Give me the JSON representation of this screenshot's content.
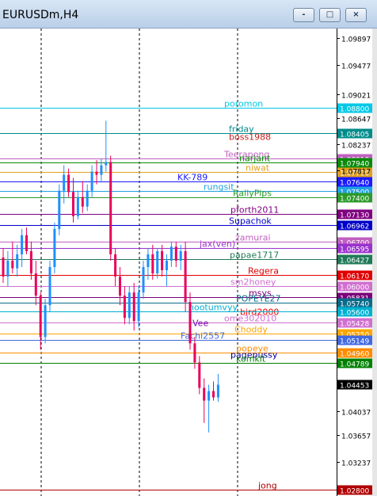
{
  "window": {
    "title": "EURUSDm,H4",
    "buttons": {
      "minimize": "-",
      "restore": "□",
      "close": "×"
    }
  },
  "colors": {
    "bull": "#1e8fff",
    "bear": "#e8005a",
    "grid": "#000000",
    "axis_bg": "#ffffff"
  },
  "chart_data": {
    "type": "candlestick",
    "price_axis": {
      "tick_labels": [
        "1.09897",
        "1.09477",
        "1.09021",
        "1.08647",
        "1.08237",
        "1.07817",
        "1.04037",
        "1.03657",
        "1.03237"
      ],
      "current_price": "1.04453"
    },
    "levels": [
      {
        "name": "poromon",
        "price": "1.08800",
        "color": "#00c8e6"
      },
      {
        "name": "friday",
        "price": "1.08405",
        "color": "#008b8b"
      },
      {
        "name": "boss1988",
        "price": "",
        "color": "#c81e1e"
      },
      {
        "name": "Teerapong",
        "price": "1.08010",
        "color": "#c060c0"
      },
      {
        "name": "narjant",
        "price": "1.07940",
        "color": "#0a8a0a"
      },
      {
        "name": "niwat",
        "price": "1.07790",
        "color": "#e0a020"
      },
      {
        "name": "KK-789",
        "price": "1.07640",
        "color": "#1a1aff"
      },
      {
        "name": "rungsit",
        "price": "1.07500",
        "color": "#20a0e0"
      },
      {
        "name": "RallyPips",
        "price": "1.07400",
        "color": "#2a9a2a"
      },
      {
        "name": "pforth2011",
        "price": "1.07130",
        "color": "#800080"
      },
      {
        "name": "Supachok",
        "price": "1.06962",
        "color": "#0000c8"
      },
      {
        "name": "zamurai",
        "price": "1.06700",
        "color": "#c060c0"
      },
      {
        "name": "jax(ven)",
        "price": "1.06595",
        "color": "#9932cc"
      },
      {
        "name": "papae1717",
        "price": "1.06427",
        "color": "#207a57"
      },
      {
        "name": "Regera",
        "price": "1.06170",
        "color": "#e00000"
      },
      {
        "name": "sm2honey",
        "price": "1.06000",
        "color": "#d070d0"
      },
      {
        "name": "msys",
        "price": "1.05831",
        "color": "#7a007a"
      },
      {
        "name": "POPEYE27",
        "price": "1.05740",
        "color": "#0a6a8a"
      },
      {
        "name": "bird2000",
        "price": "",
        "color": "#ff0000"
      },
      {
        "name": "nootumvyy",
        "price": "1.05600",
        "color": "#00b0d0"
      },
      {
        "name": "ome302010",
        "price": "1.05428",
        "color": "#d070d0"
      },
      {
        "name": "Vee",
        "price": "",
        "color": "#7a00b0"
      },
      {
        "name": "Choddy",
        "price": "1.05250",
        "color": "#ffa500"
      },
      {
        "name": "Fachi2557",
        "price": "1.05149",
        "color": "#4169e1"
      },
      {
        "name": "popeye",
        "price": "1.04960",
        "color": "#ff8c00"
      },
      {
        "name": "pagepussy",
        "price": "",
        "color": "#0000a0"
      },
      {
        "name": "komkit",
        "price": "1.04789",
        "color": "#008000"
      },
      {
        "name": "jong",
        "price": "1.02800",
        "color": "#b00000"
      }
    ],
    "candles": [
      {
        "o": 1.0645,
        "h": 1.066,
        "l": 1.0605,
        "c": 1.0615
      },
      {
        "o": 1.0615,
        "h": 1.0655,
        "l": 1.06,
        "c": 1.064
      },
      {
        "o": 1.064,
        "h": 1.067,
        "l": 1.062,
        "c": 1.0628
      },
      {
        "o": 1.0628,
        "h": 1.0665,
        "l": 1.0615,
        "c": 1.065
      },
      {
        "o": 1.065,
        "h": 1.069,
        "l": 1.063,
        "c": 1.068
      },
      {
        "o": 1.068,
        "h": 1.0692,
        "l": 1.065,
        "c": 1.0655
      },
      {
        "o": 1.0655,
        "h": 1.067,
        "l": 1.061,
        "c": 1.062
      },
      {
        "o": 1.062,
        "h": 1.064,
        "l": 1.057,
        "c": 1.0585
      },
      {
        "o": 1.0585,
        "h": 1.059,
        "l": 1.05,
        "c": 1.052
      },
      {
        "o": 1.052,
        "h": 1.058,
        "l": 1.051,
        "c": 1.057
      },
      {
        "o": 1.057,
        "h": 1.064,
        "l": 1.056,
        "c": 1.063
      },
      {
        "o": 1.063,
        "h": 1.07,
        "l": 1.062,
        "c": 1.069
      },
      {
        "o": 1.069,
        "h": 1.076,
        "l": 1.068,
        "c": 1.075
      },
      {
        "o": 1.075,
        "h": 1.079,
        "l": 1.073,
        "c": 1.0775
      },
      {
        "o": 1.0775,
        "h": 1.0785,
        "l": 1.074,
        "c": 1.0748
      },
      {
        "o": 1.0748,
        "h": 1.077,
        "l": 1.07,
        "c": 1.071
      },
      {
        "o": 1.071,
        "h": 1.075,
        "l": 1.0705,
        "c": 1.074
      },
      {
        "o": 1.074,
        "h": 1.0765,
        "l": 1.0715,
        "c": 1.0725
      },
      {
        "o": 1.0725,
        "h": 1.076,
        "l": 1.0718,
        "c": 1.075
      },
      {
        "o": 1.075,
        "h": 1.079,
        "l": 1.074,
        "c": 1.078
      },
      {
        "o": 1.078,
        "h": 1.0798,
        "l": 1.076,
        "c": 1.0775
      },
      {
        "o": 1.0775,
        "h": 1.08,
        "l": 1.0765,
        "c": 1.079
      },
      {
        "o": 1.079,
        "h": 1.086,
        "l": 1.078,
        "c": 1.0795
      },
      {
        "o": 1.0795,
        "h": 1.0805,
        "l": 1.064,
        "c": 1.065
      },
      {
        "o": 1.065,
        "h": 1.066,
        "l": 1.06,
        "c": 1.0615
      },
      {
        "o": 1.0615,
        "h": 1.063,
        "l": 1.057,
        "c": 1.0585
      },
      {
        "o": 1.0585,
        "h": 1.06,
        "l": 1.054,
        "c": 1.055
      },
      {
        "o": 1.055,
        "h": 1.06,
        "l": 1.054,
        "c": 1.059
      },
      {
        "o": 1.059,
        "h": 1.0605,
        "l": 1.053,
        "c": 1.0545
      },
      {
        "o": 1.0545,
        "h": 1.06,
        "l": 1.0535,
        "c": 1.059
      },
      {
        "o": 1.059,
        "h": 1.064,
        "l": 1.058,
        "c": 1.063
      },
      {
        "o": 1.063,
        "h": 1.066,
        "l": 1.061,
        "c": 1.065
      },
      {
        "o": 1.065,
        "h": 1.0665,
        "l": 1.061,
        "c": 1.062
      },
      {
        "o": 1.062,
        "h": 1.066,
        "l": 1.0612,
        "c": 1.0655
      },
      {
        "o": 1.0655,
        "h": 1.0665,
        "l": 1.0615,
        "c": 1.0625
      },
      {
        "o": 1.0625,
        "h": 1.065,
        "l": 1.06,
        "c": 1.064
      },
      {
        "o": 1.064,
        "h": 1.067,
        "l": 1.063,
        "c": 1.0662
      },
      {
        "o": 1.0662,
        "h": 1.067,
        "l": 1.063,
        "c": 1.064
      },
      {
        "o": 1.064,
        "h": 1.0665,
        "l": 1.0625,
        "c": 1.0655
      },
      {
        "o": 1.0655,
        "h": 1.067,
        "l": 1.056,
        "c": 1.0575
      },
      {
        "o": 1.0575,
        "h": 1.059,
        "l": 1.05,
        "c": 1.051
      },
      {
        "o": 1.051,
        "h": 1.052,
        "l": 1.047,
        "c": 1.048
      },
      {
        "o": 1.048,
        "h": 1.049,
        "l": 1.043,
        "c": 1.044
      },
      {
        "o": 1.044,
        "h": 1.0455,
        "l": 1.0385,
        "c": 1.042
      },
      {
        "o": 1.042,
        "h": 1.0445,
        "l": 1.037,
        "c": 1.0435
      },
      {
        "o": 1.0435,
        "h": 1.045,
        "l": 1.042,
        "c": 1.0425
      },
      {
        "o": 1.0425,
        "h": 1.0462,
        "l": 1.0418,
        "c": 1.0445
      }
    ],
    "grid": "vertical dashed",
    "y_range": [
      1.027,
      1.1005
    ]
  }
}
